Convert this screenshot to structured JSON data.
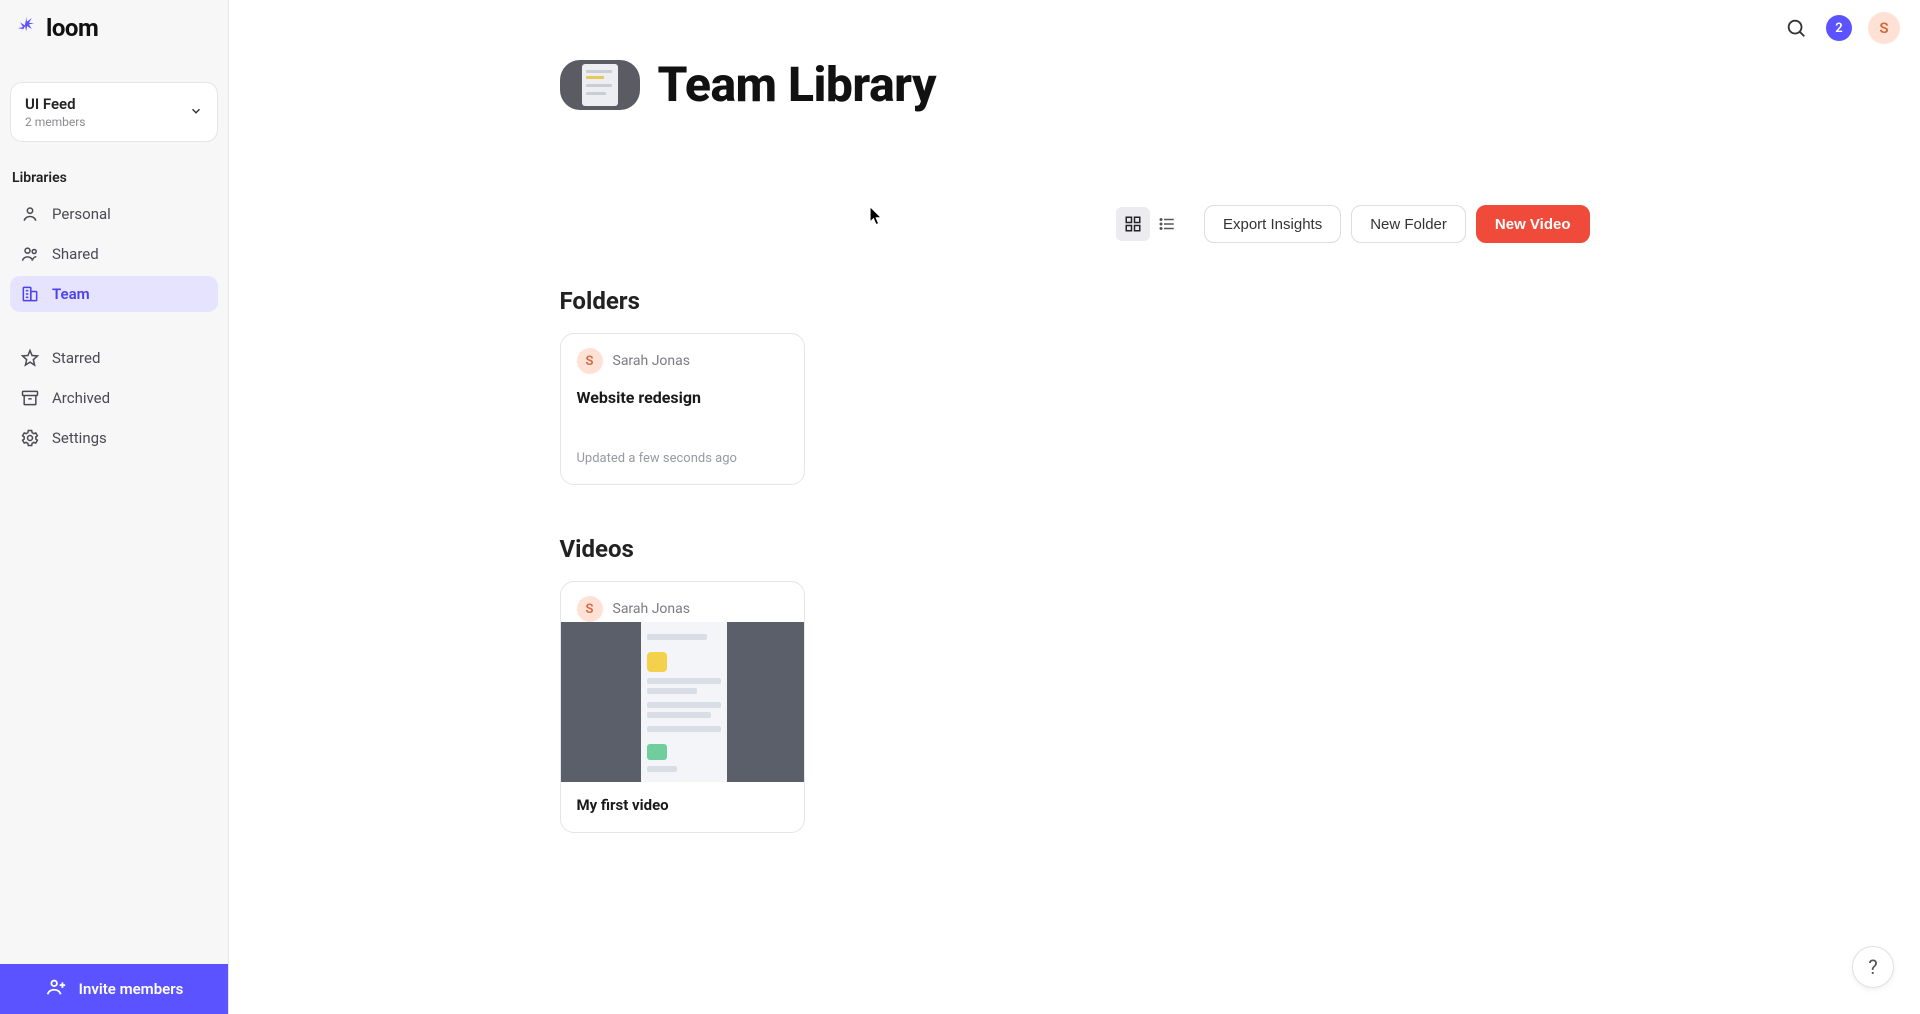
{
  "brand": {
    "name": "loom"
  },
  "workspace": {
    "name": "UI Feed",
    "members_label": "2 members"
  },
  "sidebar": {
    "section_label": "Libraries",
    "items": [
      {
        "key": "personal",
        "label": "Personal"
      },
      {
        "key": "shared",
        "label": "Shared"
      },
      {
        "key": "team",
        "label": "Team"
      },
      {
        "key": "starred",
        "label": "Starred"
      },
      {
        "key": "archived",
        "label": "Archived"
      },
      {
        "key": "settings",
        "label": "Settings"
      }
    ],
    "invite_label": "Invite members"
  },
  "topbar": {
    "notification_count": "2",
    "avatar_initial": "S"
  },
  "page": {
    "title": "Team Library"
  },
  "toolbar": {
    "export_label": "Export Insights",
    "new_folder_label": "New Folder",
    "new_video_label": "New Video"
  },
  "sections": {
    "folders_title": "Folders",
    "videos_title": "Videos"
  },
  "folders": [
    {
      "owner_initial": "S",
      "owner_name": "Sarah Jonas",
      "title": "Website redesign",
      "updated": "Updated a few seconds ago"
    }
  ],
  "videos": [
    {
      "owner_initial": "S",
      "owner_name": "Sarah Jonas",
      "title": "My first video"
    }
  ],
  "help": {
    "label": "?"
  }
}
